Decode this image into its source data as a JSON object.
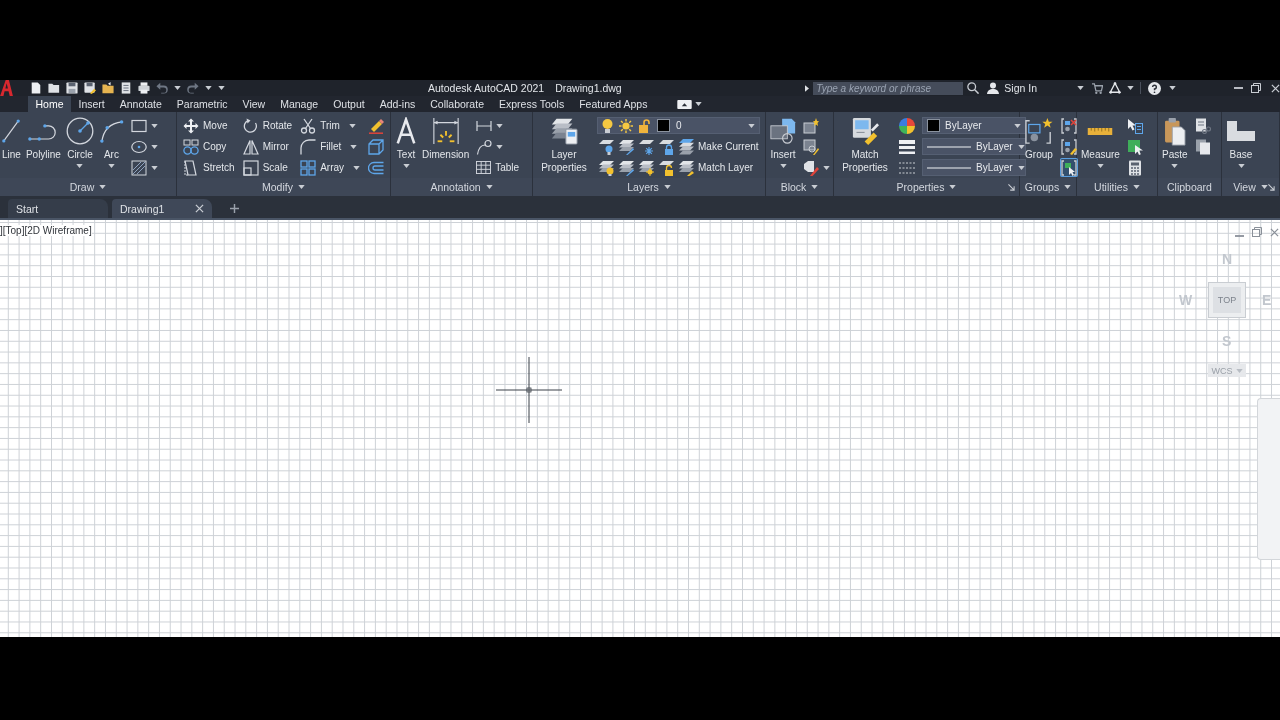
{
  "title_bar": {
    "title": "Autodesk AutoCAD 2021",
    "document": "Drawing1.dwg",
    "search": {
      "placeholder": "Type a keyword or phrase"
    },
    "sign_in": "Sign In"
  },
  "ribbon": {
    "tabs": [
      {
        "label": "Home",
        "selected": true
      },
      {
        "label": "Insert",
        "selected": false
      },
      {
        "label": "Annotate",
        "selected": false
      },
      {
        "label": "Parametric",
        "selected": false
      },
      {
        "label": "View",
        "selected": false
      },
      {
        "label": "Manage",
        "selected": false
      },
      {
        "label": "Output",
        "selected": false
      },
      {
        "label": "Add-ins",
        "selected": false
      },
      {
        "label": "Collaborate",
        "selected": false
      },
      {
        "label": "Express Tools",
        "selected": false
      },
      {
        "label": "Featured Apps",
        "selected": false
      }
    ],
    "panels": [
      {
        "title": "Draw",
        "menu": true,
        "launcher": false,
        "large": [
          {
            "label": "Line",
            "dropdown": false
          },
          {
            "label": "Polyline",
            "dropdown": false
          },
          {
            "label": "Circle",
            "dropdown": true
          },
          {
            "label": "Arc",
            "dropdown": true
          }
        ],
        "small": [
          [
            {
              "kind": "tool",
              "dropdown": true
            }
          ],
          [
            {
              "kind": "tool",
              "dropdown": true
            }
          ],
          [
            {
              "kind": "tool",
              "dropdown": true
            }
          ]
        ]
      },
      {
        "title": "Modify",
        "menu": true,
        "launcher": false,
        "small": [
          [
            {
              "kind": "tool",
              "label": "Move",
              "dropdown": false
            },
            {
              "kind": "tool",
              "label": "Rotate",
              "dropdown": false
            },
            {
              "kind": "tool",
              "label": "Trim",
              "dropdown": true
            },
            {
              "kind": "tool",
              "dropdown": false
            }
          ],
          [
            {
              "kind": "tool",
              "label": "Copy",
              "dropdown": false
            },
            {
              "kind": "tool",
              "label": "Mirror",
              "dropdown": false
            },
            {
              "kind": "tool",
              "label": "Fillet",
              "dropdown": true
            },
            {
              "kind": "tool",
              "dropdown": false
            }
          ],
          [
            {
              "kind": "tool",
              "label": "Stretch",
              "dropdown": false
            },
            {
              "kind": "tool",
              "label": "Scale",
              "dropdown": false
            },
            {
              "kind": "tool",
              "label": "Array",
              "dropdown": true
            },
            {
              "kind": "tool",
              "dropdown": false
            }
          ]
        ]
      },
      {
        "title": "Annotation",
        "menu": true,
        "launcher": false,
        "large": [
          {
            "label": "Text",
            "dropdown": true
          },
          {
            "label": "Dimension",
            "dropdown": false
          }
        ],
        "small": [
          [
            {
              "kind": "tool",
              "dropdown": true
            }
          ],
          [
            {
              "kind": "tool",
              "dropdown": true
            }
          ],
          [
            {
              "kind": "tool",
              "label": "Table",
              "dropdown": false
            }
          ]
        ]
      },
      {
        "title": "Layers",
        "menu": true,
        "launcher": false,
        "large": [
          {
            "label": "Layer Properties",
            "dropdown": false
          }
        ],
        "small": [
          [
            {
              "kind": "layer_combo",
              "value": "0",
              "color": "#000000",
              "on": true,
              "frozen": false,
              "locked": false
            }
          ],
          [
            {
              "kind": "tool",
              "dropdown": false
            },
            {
              "kind": "tool",
              "dropdown": false
            },
            {
              "kind": "tool",
              "dropdown": false
            },
            {
              "kind": "tool",
              "dropdown": false
            },
            {
              "kind": "tool",
              "label": "Make Current",
              "dropdown": false
            }
          ],
          [
            {
              "kind": "tool",
              "dropdown": false
            },
            {
              "kind": "tool",
              "dropdown": false
            },
            {
              "kind": "tool",
              "dropdown": false
            },
            {
              "kind": "tool",
              "dropdown": false
            },
            {
              "kind": "tool",
              "label": "Match Layer",
              "dropdown": false
            }
          ]
        ]
      },
      {
        "title": "Block",
        "menu": true,
        "launcher": false,
        "large": [
          {
            "label": "Insert",
            "dropdown": true
          }
        ],
        "small": [
          [
            {
              "kind": "tool",
              "dropdown": false
            }
          ],
          [
            {
              "kind": "tool",
              "dropdown": false
            }
          ],
          [
            {
              "kind": "tool",
              "dropdown": true
            }
          ]
        ]
      },
      {
        "title": "Properties",
        "menu": true,
        "launcher": true,
        "large": [
          {
            "label": "Match Properties",
            "dropdown": false
          }
        ],
        "small": [
          [
            {
              "kind": "tool",
              "dropdown": false
            },
            {
              "kind": "combo",
              "value": "ByLayer",
              "color": "#000000"
            }
          ],
          [
            {
              "kind": "tool",
              "dropdown": false
            },
            {
              "kind": "combo",
              "value": "ByLayer"
            }
          ],
          [
            {
              "kind": "tool",
              "dropdown": false
            },
            {
              "kind": "combo",
              "value": "ByLayer"
            }
          ]
        ]
      },
      {
        "title": "Groups",
        "menu": true,
        "launcher": false,
        "large": [
          {
            "label": "Group",
            "dropdown": false
          }
        ],
        "small": [
          [
            {
              "kind": "tool",
              "dropdown": false,
              "on": false
            }
          ],
          [
            {
              "kind": "tool",
              "dropdown": false,
              "on": false
            }
          ],
          [
            {
              "kind": "tool",
              "dropdown": false,
              "on": true
            }
          ]
        ]
      },
      {
        "title": "Utilities",
        "menu": true,
        "launcher": false,
        "large": [
          {
            "label": "Measure",
            "dropdown": true
          }
        ],
        "small": [
          [
            {
              "kind": "tool",
              "dropdown": false
            }
          ],
          [
            {
              "kind": "tool",
              "dropdown": false
            }
          ],
          [
            {
              "kind": "tool",
              "dropdown": false
            }
          ]
        ]
      },
      {
        "title": "Clipboard",
        "menu": false,
        "launcher": false,
        "large": [
          {
            "label": "Paste",
            "dropdown": true
          }
        ],
        "small": [
          [
            {
              "kind": "tool",
              "dropdown": false
            }
          ],
          [
            {
              "kind": "tool",
              "dropdown": false
            }
          ]
        ]
      },
      {
        "title": "View",
        "menu": true,
        "launcher": true,
        "large": [
          {
            "label": "Base",
            "dropdown": true
          }
        ]
      }
    ]
  },
  "file_tabs": [
    {
      "label": "Start",
      "selected": false
    },
    {
      "label": "Drawing1",
      "selected": true
    }
  ],
  "viewport": {
    "label": "][Top][2D Wireframe]",
    "viewcube": {
      "north": "N",
      "west": "W",
      "face": "TOP",
      "east": "E",
      "south": "S",
      "ucs": "WCS"
    }
  }
}
